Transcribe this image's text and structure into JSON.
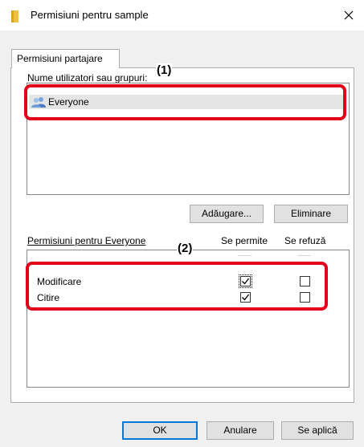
{
  "window": {
    "title": "Permisiuni pentru sample",
    "close_glyph": "×",
    "folder_icon": "folder-icon"
  },
  "tabs": [
    {
      "label": "Permisiuni partajare",
      "active": true
    }
  ],
  "share_permissions": {
    "group_caption": "Nume utilizatori sau grupuri:",
    "users": [
      {
        "name": "Everyone",
        "icon": "users-icon",
        "selected": true
      }
    ],
    "add_button": {
      "label": "Adăugare...",
      "mnemonic": "d"
    },
    "remove_button": {
      "label": "Eliminare",
      "mnemonic": "l"
    }
  },
  "permissions_table": {
    "header_label": "Permisiuni pentru Everyone",
    "allow_column": "Se permite",
    "deny_column": "Se refuză",
    "rows": [
      {
        "label": "Modificare",
        "allow": true,
        "deny": false,
        "allow_focused": true
      },
      {
        "label": "Citire",
        "allow": true,
        "deny": false
      }
    ]
  },
  "footer": {
    "ok_label": "OK",
    "cancel_label": "Anulare",
    "apply_label": "Se aplică"
  },
  "callouts": {
    "one": "(1)",
    "two": "(2)",
    "color": "#e2001a"
  }
}
